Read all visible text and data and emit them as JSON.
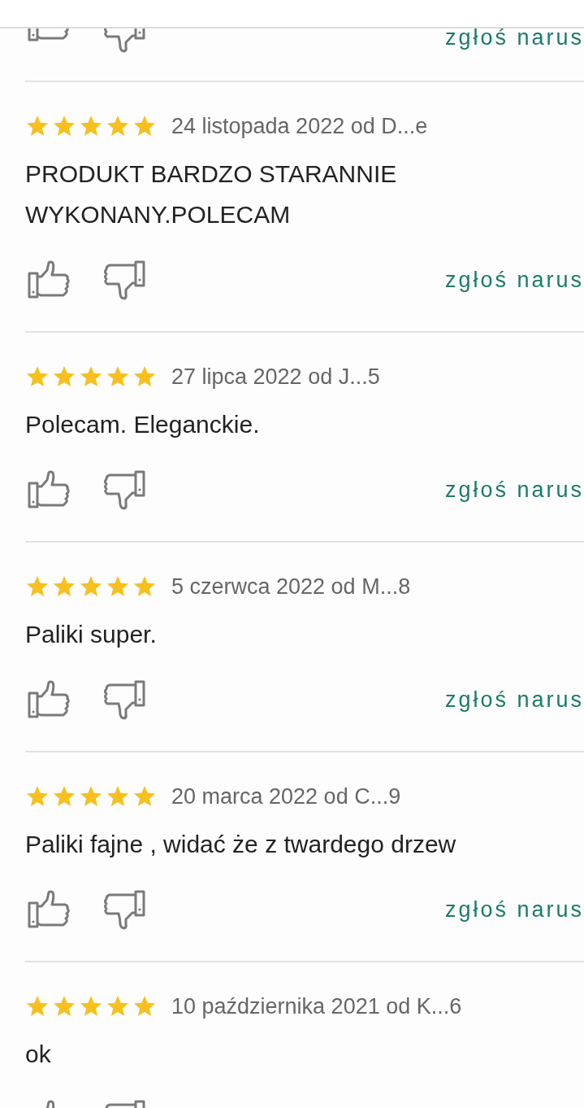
{
  "top_actions": {
    "report_link": "zgłoś narus"
  },
  "reviews": [
    {
      "stars": 5,
      "meta": "24 listopada 2022 od D...e",
      "text": "PRODUKT BARDZO STARANNIE WYKONANY.POLECAM",
      "report_link": "zgłoś narus"
    },
    {
      "stars": 5,
      "meta": "27 lipca 2022 od J...5",
      "text": "Polecam. Eleganckie.",
      "report_link": "zgłoś narus"
    },
    {
      "stars": 5,
      "meta": "5 czerwca 2022 od M...8",
      "text": "Paliki super.",
      "report_link": "zgłoś narus"
    },
    {
      "stars": 5,
      "meta": "20 marca 2022 od C...9",
      "text": "Paliki fajne , widać że z twardego drzew",
      "report_link": "zgłoś narus"
    },
    {
      "stars": 5,
      "meta": "10 października 2021 od K...6",
      "text": "ok"
    }
  ]
}
